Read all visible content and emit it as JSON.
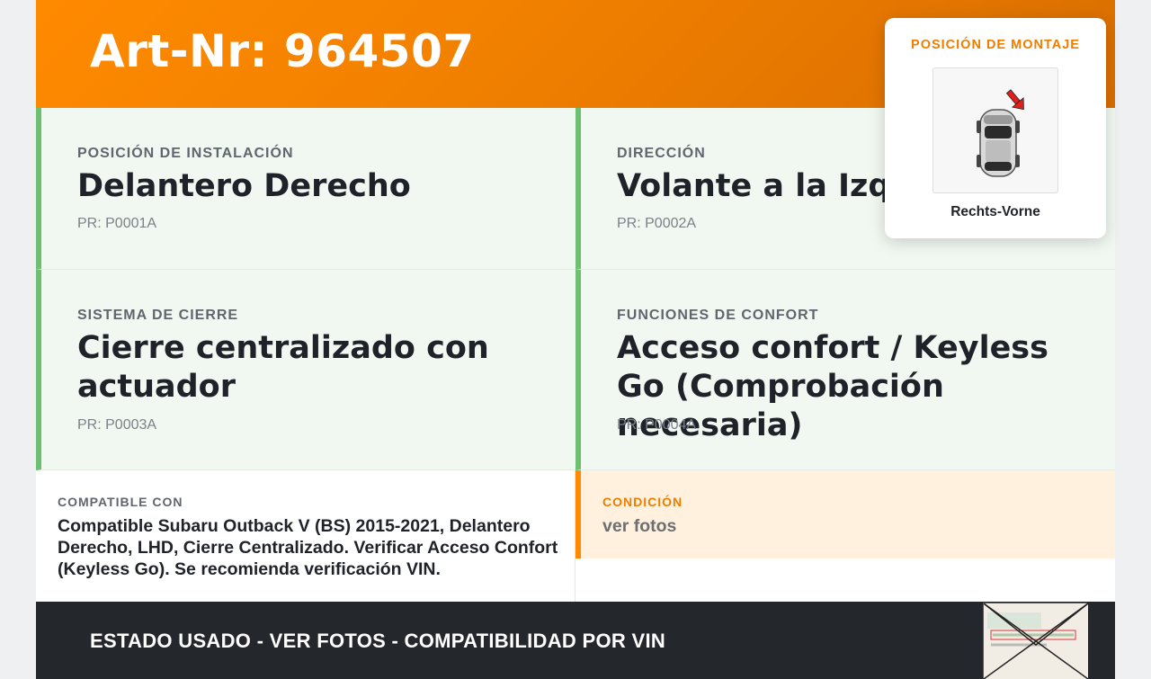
{
  "header": {
    "article_number": "Art-Nr: 964507"
  },
  "details": [
    {
      "label": "POSICIÓN DE INSTALACIÓN",
      "value": "Delantero Derecho",
      "pr": "PR: P0001A"
    },
    {
      "label": "DIRECCIÓN",
      "value": "Volante a la Izquierda",
      "pr": "PR: P0002A"
    },
    {
      "label": "SISTEMA DE CIERRE",
      "value": "Cierre centralizado con actuador",
      "pr": "PR: P0003A"
    },
    {
      "label": "FUNCIONES DE CONFORT",
      "value": "Acceso confort / Keyless Go (Comprobación necesaria)",
      "pr": "PR: P0004A"
    }
  ],
  "compatibility": {
    "label": "COMPATIBLE CON",
    "text": "Compatible Subaru Outback V (BS) 2015-2021, Delantero Derecho, LHD, Cierre Centralizado. Verificar Acceso Confort (Keyless Go). Se recomienda verificación VIN."
  },
  "condition": {
    "label": "CONDICIÓN",
    "text": "ver fotos"
  },
  "footer": {
    "text": "ESTADO USADO - VER FOTOS - COMPATIBILIDAD POR VIN"
  },
  "mount_popup": {
    "title": "POSICIÓN DE MONTAJE",
    "caption": "Rechts-Vorne",
    "icon": "car-top-view-icon"
  },
  "colors": {
    "header_orange": "#ff8a00",
    "accent_green": "#6cc06f",
    "accent_orange": "#ee7d00",
    "footer_dark": "#24272b",
    "arrow_red": "#e0201b"
  }
}
